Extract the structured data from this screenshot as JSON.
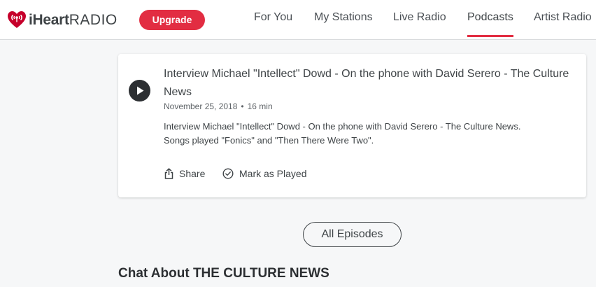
{
  "header": {
    "logo": {
      "brand_bold": "iHeart",
      "brand_light": "RADIO",
      "icon": "iheart-logo-icon"
    },
    "upgrade_label": "Upgrade",
    "nav": [
      {
        "label": "For You",
        "active": false
      },
      {
        "label": "My Stations",
        "active": false
      },
      {
        "label": "Live Radio",
        "active": false
      },
      {
        "label": "Podcasts",
        "active": true
      },
      {
        "label": "Artist Radio",
        "active": false
      }
    ]
  },
  "episode": {
    "title": "Interview Michael \"Intellect\" Dowd - On the phone with David Serero - The Culture News",
    "date": "November 25, 2018",
    "separator": "•",
    "duration": "16 min",
    "description": "Interview Michael \"Intellect\" Dowd - On the phone with David Serero - The Culture News. Songs played \"Fonics\" and \"Then There Were Two\".",
    "actions": {
      "share_label": "Share",
      "share_icon": "share-icon",
      "mark_played_label": "Mark as Played",
      "mark_played_icon": "check-circle-icon"
    }
  },
  "all_episodes_label": "All Episodes",
  "chat_heading": "Chat About THE CULTURE NEWS",
  "colors": {
    "accent": "#e22d42",
    "text": "#3f4447",
    "background": "#f6f7f8"
  }
}
